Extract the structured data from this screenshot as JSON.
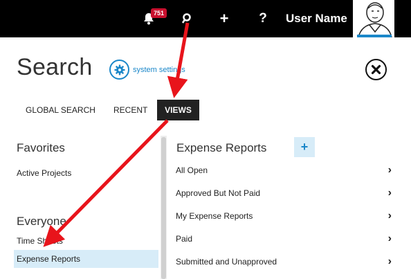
{
  "topbar": {
    "notification_count": "751",
    "user_name": "User Name",
    "icons": [
      "bell-icon",
      "search-icon",
      "plus-icon",
      "help-icon"
    ]
  },
  "header": {
    "title": "Search",
    "settings_label": "system settings"
  },
  "tabs": [
    {
      "label": "GLOBAL SEARCH"
    },
    {
      "label": "RECENT"
    },
    {
      "label": "VIEWS",
      "active": true
    }
  ],
  "left": {
    "favorites_heading": "Favorites",
    "favorites": [
      "Active Projects"
    ],
    "everyone_heading": "Everyone",
    "everyone": [
      "Time Sheets",
      "Expense Reports"
    ],
    "selected": "Expense Reports"
  },
  "right": {
    "title": "Expense Reports",
    "add_label": "+",
    "views": [
      "All Open",
      "Approved But Not Paid",
      "My Expense Reports",
      "Paid",
      "Submitted and Unapproved"
    ]
  },
  "colors": {
    "accent": "#1b87c9",
    "highlight": "#d7ecf8",
    "arrow": "#e8141b",
    "badge": "#c8102e"
  }
}
